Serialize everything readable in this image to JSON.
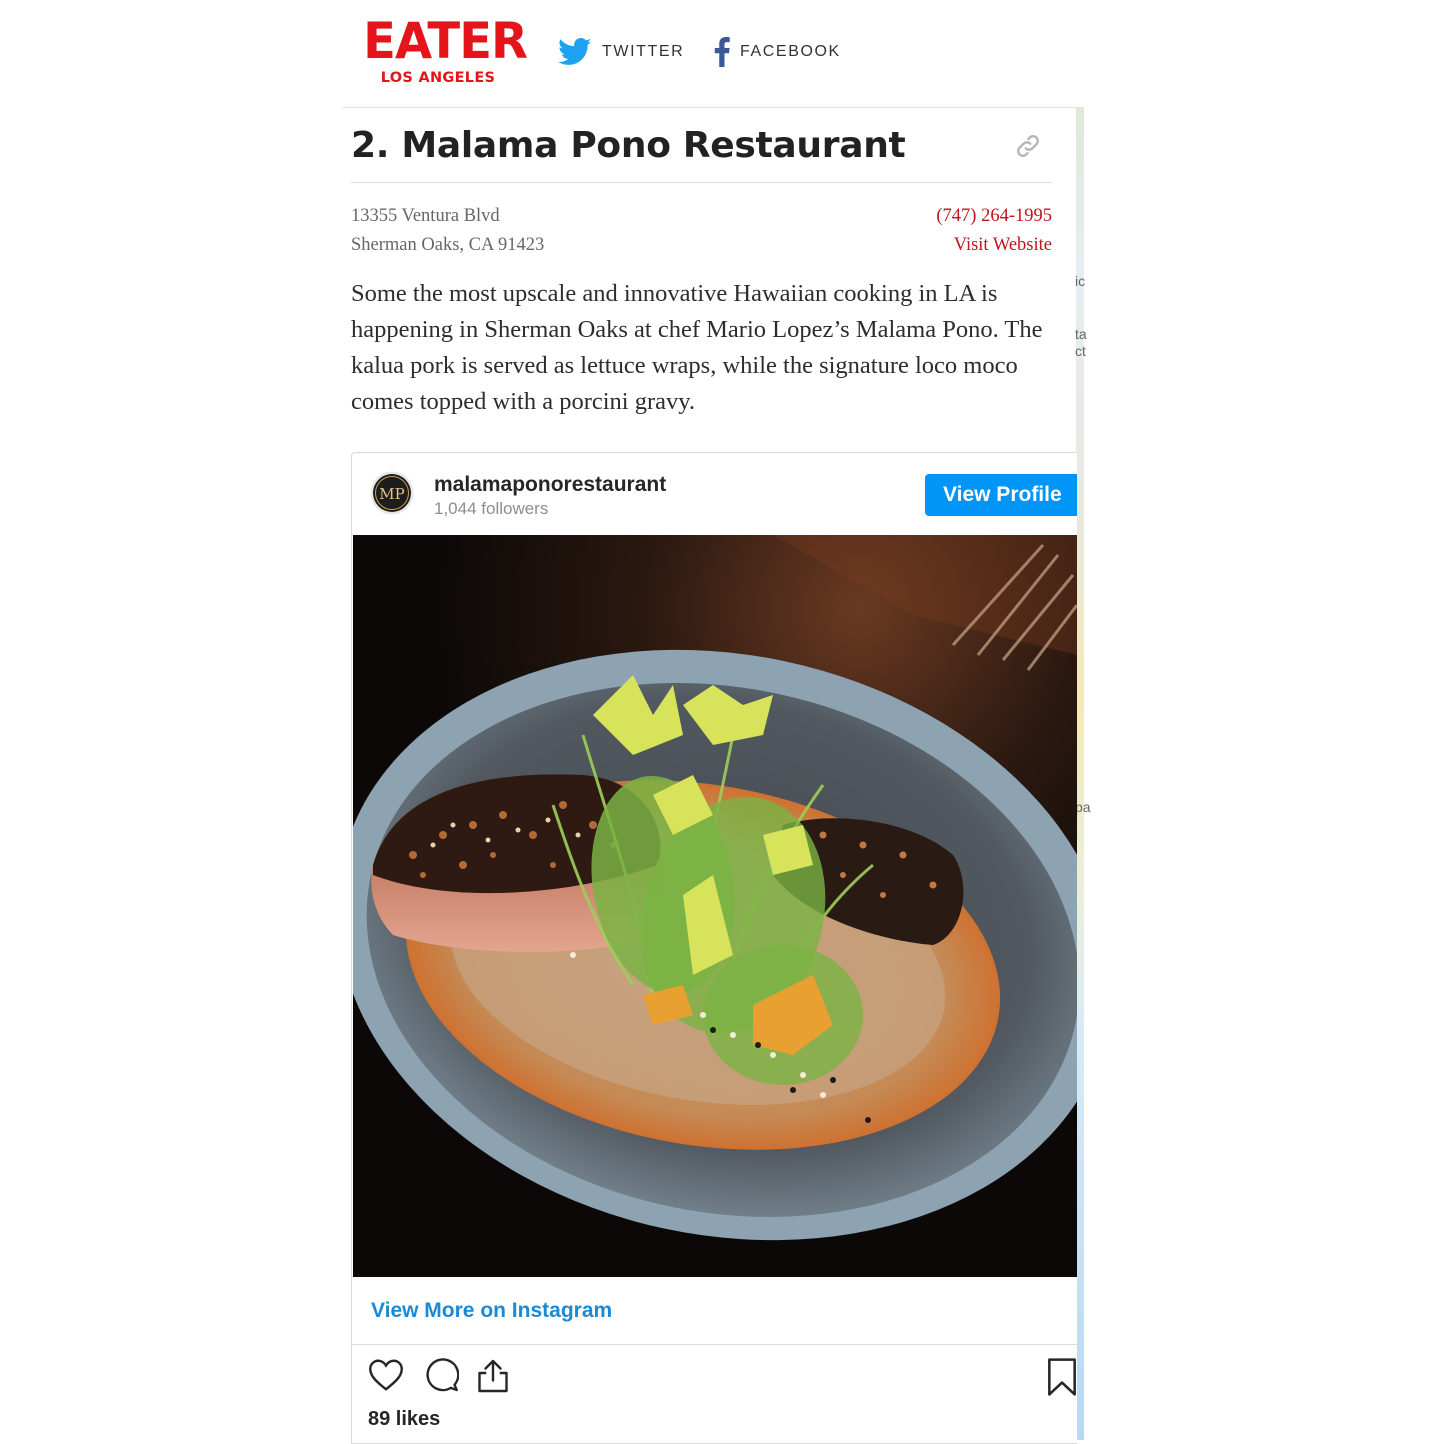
{
  "brand": {
    "logo_main": "EATER",
    "logo_sub": "LOS ANGELES",
    "color": "#e5141b"
  },
  "share": {
    "twitter_label": "TWITTER",
    "facebook_label": "FACEBOOK",
    "twitter_icon": "twitter-bird-icon",
    "facebook_icon": "facebook-f-icon"
  },
  "map_fragments": [
    "ic",
    "ta\nct",
    "pa"
  ],
  "entry": {
    "title": "2. Malama Pono Restaurant",
    "link_icon": "link-icon",
    "address_line1": "13355 Ventura Blvd",
    "address_line2": "Sherman Oaks, CA 91423",
    "phone": "(747) 264-1995",
    "website_label": "Visit Website",
    "description": "Some the most upscale and innovative Hawaiian cooking in LA is happening in Sherman Oaks at chef Mario Lopez’s Malama Pono. The kalua pork is served as lettuce wraps, while the signature loco moco comes topped with a porcini gravy."
  },
  "instagram": {
    "avatar_initials": "MP",
    "username": "malamaponorestaurant",
    "followers": "1,044 followers",
    "view_profile_label": "View Profile",
    "view_more_label": "View More on Instagram",
    "likes": "89 likes",
    "accent": "#0095f6",
    "actions": [
      "heart-icon",
      "comment-icon",
      "share-icon",
      "bookmark-icon"
    ]
  }
}
